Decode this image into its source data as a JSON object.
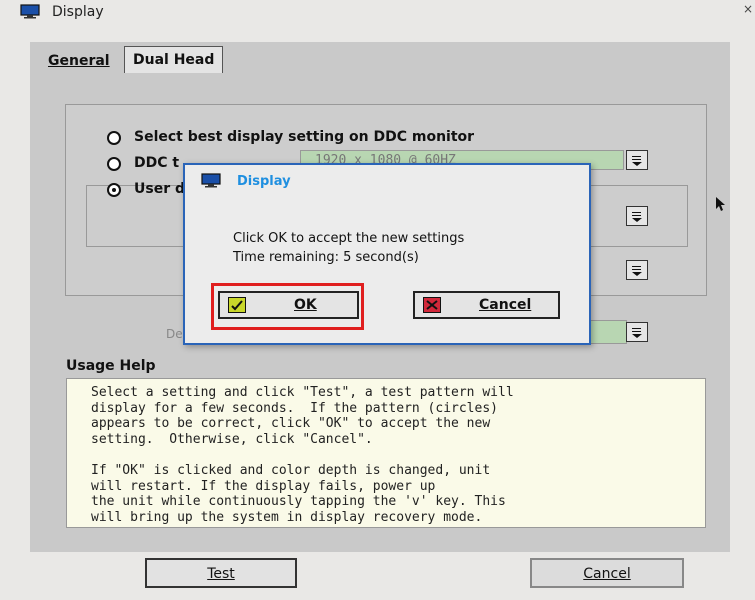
{
  "window": {
    "title": "Display",
    "close_glyph": "×"
  },
  "tabs": [
    {
      "label": "General"
    },
    {
      "label": "Dual Head"
    }
  ],
  "settings": {
    "option_best": "Select best display setting on DDC monitor",
    "option_ddc": "DDC t",
    "option_user": "User d",
    "ddc_value": "1920 x 1080 @ 60HZ",
    "de_label": "De"
  },
  "usage": {
    "label": "Usage Help",
    "para1": "Select a setting and click \"Test\", a test pattern will\ndisplay for a few seconds.  If the pattern (circles)\nappears to be correct, click \"OK\" to accept the new\nsetting.  Otherwise, click \"Cancel\".",
    "para2": "If \"OK\" is clicked and color depth is changed, unit\nwill restart. If the display fails, power up\nthe unit while continuously tapping the 'v' key. This\nwill bring up the system in display recovery mode."
  },
  "buttons": {
    "test": "Test",
    "cancel": "Cancel"
  },
  "dialog": {
    "title": "Display",
    "message": "Click OK to accept the new settings",
    "time_remaining": "Time remaining: 5 second(s)",
    "ok_label": "OK",
    "cancel_label": "Cancel"
  },
  "colors": {
    "dialog_border": "#2a64b8",
    "dialog_title": "#1f8fe0",
    "highlight": "#e01f1f",
    "ok_icon": "#c9d72a",
    "cancel_icon": "#d2283a"
  },
  "icons": {
    "title_icon": "monitor-icon",
    "dialog_icon": "monitor-icon",
    "ok_icon": "checkmark-icon",
    "cancel_icon": "cancel-x-icon"
  }
}
